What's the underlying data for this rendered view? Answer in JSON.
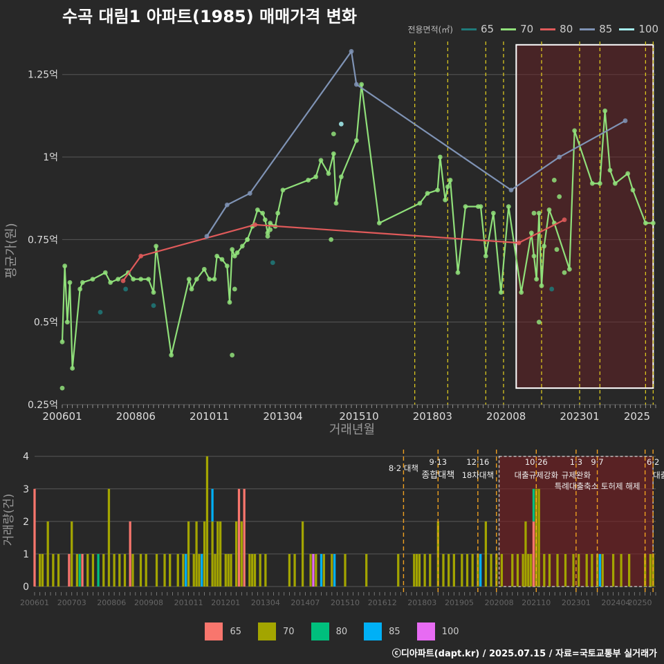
{
  "title": "수곡 대림1 아파트(1985) 매매가격 변화",
  "legend_title": "전용면적(㎡)",
  "credit": "ⓒ디아파트(dapt.kr) / 2025.07.15 / 자료=국토교통부 실거래가",
  "colors": {
    "background": "#282828",
    "grid": "#575757",
    "policy": "#e6d21e",
    "shade": "#6e1f24"
  },
  "price_series_colors": {
    "65": "#1f7a7a",
    "70": "#90e07a",
    "80": "#e05a5a",
    "85": "#7f93b5",
    "100": "#a5f1f2"
  },
  "volume_series_colors": {
    "65": "#f8766d",
    "70": "#a3a500",
    "80": "#00bf7d",
    "85": "#00b0f6",
    "100": "#e76bf3"
  },
  "chart_data": [
    {
      "type": "line",
      "name": "price",
      "xlabel": "거래년월",
      "ylabel": "평균가(원)",
      "x_ticks": [
        "200601",
        "200806",
        "201011",
        "201304",
        "201510",
        "201803",
        "202008",
        "202301",
        "2025"
      ],
      "y_ticks": [
        {
          "value": 0.25,
          "label": "0.25억"
        },
        {
          "value": 0.5,
          "label": "0.5억"
        },
        {
          "value": 0.75,
          "label": "0.75억"
        },
        {
          "value": 1.0,
          "label": "1억"
        },
        {
          "value": 1.25,
          "label": "1.25억"
        }
      ],
      "ylim": [
        0.25,
        1.35
      ],
      "x_start": "2006-01",
      "x_end": "2025-07",
      "legend_items": [
        "65",
        "70",
        "80",
        "85",
        "100"
      ],
      "highlight_box": {
        "from": "2020-12",
        "to": "2025-06",
        "ymin": 0.3,
        "ymax": 1.34
      },
      "policy_lines": [
        "2017-08",
        "2018-09",
        "2019-12",
        "2020-07",
        "2021-10",
        "2023-01",
        "2023-09",
        "2025-03",
        "2025-06"
      ],
      "series": [
        {
          "name": "70",
          "line": true,
          "points": [
            [
              "2006-01",
              0.44
            ],
            [
              "2006-02",
              0.67
            ],
            [
              "2006-03",
              0.5
            ],
            [
              "2006-04",
              0.62
            ],
            [
              "2006-05",
              0.36
            ],
            [
              "2006-08",
              0.6
            ],
            [
              "2006-09",
              0.62
            ],
            [
              "2007-01",
              0.63
            ],
            [
              "2007-06",
              0.65
            ],
            [
              "2007-08",
              0.62
            ],
            [
              "2007-11",
              0.63
            ],
            [
              "2008-03",
              0.65
            ],
            [
              "2008-05",
              0.63
            ],
            [
              "2008-08",
              0.63
            ],
            [
              "2008-11",
              0.63
            ],
            [
              "2009-01",
              0.59
            ],
            [
              "2009-02",
              0.73
            ],
            [
              "2009-08",
              0.4
            ],
            [
              "2010-03",
              0.63
            ],
            [
              "2010-04",
              0.6
            ],
            [
              "2010-06",
              0.63
            ],
            [
              "2010-09",
              0.66
            ],
            [
              "2010-11",
              0.63
            ],
            [
              "2011-01",
              0.63
            ],
            [
              "2011-02",
              0.7
            ],
            [
              "2011-04",
              0.69
            ],
            [
              "2011-06",
              0.67
            ],
            [
              "2011-07",
              0.56
            ],
            [
              "2011-08",
              0.72
            ],
            [
              "2011-09",
              0.7
            ],
            [
              "2011-10",
              0.71
            ],
            [
              "2011-12",
              0.73
            ],
            [
              "2012-02",
              0.75
            ],
            [
              "2012-04",
              0.79
            ],
            [
              "2012-06",
              0.84
            ],
            [
              "2012-08",
              0.83
            ],
            [
              "2012-09",
              0.81
            ],
            [
              "2012-10",
              0.77
            ],
            [
              "2012-11",
              0.8
            ],
            [
              "2013-01",
              0.79
            ],
            [
              "2013-02",
              0.83
            ],
            [
              "2013-04",
              0.9
            ],
            [
              "2014-02",
              0.93
            ],
            [
              "2014-05",
              0.94
            ],
            [
              "2014-07",
              0.99
            ],
            [
              "2014-10",
              0.95
            ],
            [
              "2014-12",
              1.01
            ],
            [
              "2015-01",
              0.86
            ],
            [
              "2015-03",
              0.94
            ],
            [
              "2015-09",
              1.05
            ],
            [
              "2015-11",
              1.22
            ],
            [
              "2016-06",
              0.8
            ],
            [
              "2017-10",
              0.86
            ],
            [
              "2018-01",
              0.89
            ],
            [
              "2018-05",
              0.9
            ],
            [
              "2018-06",
              1.0
            ],
            [
              "2018-08",
              0.87
            ],
            [
              "2018-09",
              0.91
            ],
            [
              "2018-10",
              0.93
            ],
            [
              "2019-01",
              0.65
            ],
            [
              "2019-04",
              0.85
            ],
            [
              "2019-09",
              0.85
            ],
            [
              "2019-10",
              0.85
            ],
            [
              "2019-12",
              0.7
            ],
            [
              "2020-03",
              0.83
            ],
            [
              "2020-06",
              0.59
            ],
            [
              "2020-09",
              0.85
            ],
            [
              "2021-02",
              0.59
            ],
            [
              "2021-06",
              0.77
            ],
            [
              "2021-07",
              0.7
            ],
            [
              "2021-08",
              0.63
            ],
            [
              "2021-09",
              0.83
            ],
            [
              "2021-10",
              0.61
            ],
            [
              "2021-11",
              0.73
            ],
            [
              "2022-01",
              0.84
            ],
            [
              "2022-03",
              0.8
            ],
            [
              "2022-09",
              0.66
            ],
            [
              "2022-11",
              1.08
            ],
            [
              "2023-06",
              0.92
            ],
            [
              "2023-09",
              0.92
            ],
            [
              "2023-11",
              1.14
            ],
            [
              "2024-01",
              0.96
            ],
            [
              "2024-03",
              0.92
            ],
            [
              "2024-08",
              0.95
            ],
            [
              "2024-10",
              0.9
            ],
            [
              "2025-03",
              0.8
            ],
            [
              "2025-06",
              0.8
            ]
          ]
        },
        {
          "name": "70",
          "line": false,
          "points": [
            [
              "2006-01",
              0.3
            ],
            [
              "2011-08",
              0.4
            ],
            [
              "2011-09",
              0.6
            ],
            [
              "2012-02",
              0.75
            ],
            [
              "2012-10",
              0.76
            ],
            [
              "2012-11",
              0.78
            ],
            [
              "2014-12",
              1.07
            ],
            [
              "2014-11",
              0.75
            ],
            [
              "2021-07",
              0.83
            ],
            [
              "2021-09",
              0.5
            ],
            [
              "2022-03",
              0.93
            ],
            [
              "2022-05",
              0.88
            ],
            [
              "2022-07",
              0.65
            ],
            [
              "2022-04",
              0.72
            ]
          ]
        },
        {
          "name": "65",
          "line": false,
          "points": [
            [
              "2007-04",
              0.53
            ],
            [
              "2008-02",
              0.6
            ],
            [
              "2009-01",
              0.55
            ],
            [
              "2012-12",
              0.68
            ],
            [
              "2022-02",
              0.6
            ]
          ]
        },
        {
          "name": "80",
          "line": true,
          "points": [
            [
              "2008-01",
              0.625
            ],
            [
              "2008-08",
              0.7
            ],
            [
              "2012-05",
              0.795
            ],
            [
              "2021-01",
              0.74
            ],
            [
              "2022-07",
              0.81
            ]
          ]
        },
        {
          "name": "85",
          "line": true,
          "points": [
            [
              "2010-10",
              0.76
            ],
            [
              "2011-06",
              0.855
            ],
            [
              "2012-03",
              0.89
            ],
            [
              "2015-07",
              1.32
            ],
            [
              "2015-09",
              1.22
            ],
            [
              "2020-10",
              0.9
            ],
            [
              "2022-05",
              1.0
            ],
            [
              "2024-07",
              1.11
            ]
          ]
        },
        {
          "name": "100",
          "line": false,
          "points": [
            [
              "2015-03",
              1.1
            ]
          ]
        }
      ]
    },
    {
      "type": "bar",
      "name": "volume",
      "xlabel": "",
      "ylabel": "거래량(건)",
      "x_ticks": [
        "200601",
        "200703",
        "200806",
        "200908",
        "201011",
        "201201",
        "201304",
        "201407",
        "201510",
        "201612",
        "201803",
        "201905",
        "202008",
        "202110",
        "202301",
        "202404",
        "20250"
      ],
      "y_ticks": [
        0,
        1,
        2,
        3,
        4
      ],
      "ylim": [
        0,
        4.1
      ],
      "x_start": "2006-01",
      "x_end": "2025-07",
      "highlight_box": {
        "from": "2020-08",
        "to": "2025-06",
        "ymin": 0,
        "ymax": 4.0
      },
      "policy_lines": [
        "2017-08",
        "2018-09",
        "2019-12",
        "2020-07",
        "2021-10",
        "2023-01",
        "2023-09",
        "2025-03",
        "2025-06"
      ],
      "annotations": [
        {
          "at": "2017-08",
          "date": "",
          "label": "8·2 대책"
        },
        {
          "at": "2018-09",
          "date": "9·13",
          "label": "종합대책"
        },
        {
          "at": "2019-12",
          "date": "12·16",
          "label": "18차대책"
        },
        {
          "at": "2021-10",
          "date": "10·26",
          "label": "대출규제강화"
        },
        {
          "at": "2023-01",
          "date": "1·3",
          "label": "규제완화"
        },
        {
          "at": "2023-09",
          "date": "9·7",
          "label": "특례대출축소 토허제 해제"
        },
        {
          "at": "2025-06",
          "date": "6·2",
          "label": "대출규"
        }
      ],
      "series": [
        {
          "name": "65",
          "values": {
            "2006-01": 3,
            "2007-02": 1,
            "2007-07": 1,
            "2009-01": 2,
            "2012-06": 3,
            "2012-08": 3,
            "2021-09": 2
          }
        },
        {
          "name": "70",
          "values": {
            "2006-03": 1,
            "2006-04": 1,
            "2006-06": 2,
            "2006-08": 1,
            "2006-10": 1,
            "2007-03": 2,
            "2007-05": 1,
            "2007-09": 1,
            "2007-11": 1,
            "2008-03": 1,
            "2008-05": 3,
            "2008-07": 1,
            "2008-09": 1,
            "2008-11": 1,
            "2009-02": 1,
            "2009-05": 1,
            "2009-07": 1,
            "2009-11": 1,
            "2010-02": 1,
            "2010-04": 1,
            "2010-07": 1,
            "2010-09": 1,
            "2010-11": 2,
            "2011-01": 1,
            "2011-02": 2,
            "2011-03": 1,
            "2011-05": 2,
            "2011-06": 4,
            "2011-08": 2,
            "2011-09": 1,
            "2011-10": 2,
            "2011-11": 2,
            "2012-01": 1,
            "2012-02": 1,
            "2012-03": 1,
            "2012-05": 2,
            "2012-07": 2,
            "2012-10": 1,
            "2012-11": 1,
            "2012-12": 1,
            "2013-02": 1,
            "2013-04": 1,
            "2014-01": 1,
            "2014-03": 1,
            "2014-06": 2,
            "2014-09": 1,
            "2014-11": 1,
            "2015-02": 1,
            "2015-05": 1,
            "2015-10": 1,
            "2016-06": 1,
            "2017-06": 1,
            "2017-12": 1,
            "2018-01": 1,
            "2018-02": 1,
            "2018-04": 1,
            "2018-06": 1,
            "2018-09": 2,
            "2018-11": 1,
            "2019-01": 1,
            "2019-03": 1,
            "2019-06": 1,
            "2019-08": 1,
            "2019-10": 1,
            "2019-12": 1,
            "2020-03": 2,
            "2020-05": 1,
            "2020-07": 1,
            "2020-09": 1,
            "2021-01": 1,
            "2021-03": 1,
            "2021-05": 1,
            "2021-06": 2,
            "2021-07": 1,
            "2021-08": 1,
            "2021-10": 3,
            "2021-11": 3,
            "2022-01": 1,
            "2022-03": 1,
            "2022-06": 1,
            "2022-09": 1,
            "2022-12": 1,
            "2023-02": 1,
            "2023-05": 1,
            "2023-07": 1,
            "2023-09": 1,
            "2023-11": 1,
            "2024-03": 1,
            "2024-06": 1,
            "2024-09": 1,
            "2025-03": 1,
            "2025-05": 1,
            "2025-06": 1
          }
        },
        {
          "name": "80",
          "values": {
            "2007-06": 1,
            "2008-01": 1,
            "2021-09": 1
          }
        },
        {
          "name": "85",
          "values": {
            "2010-10": 1,
            "2011-04": 1,
            "2011-08": 1,
            "2015-01": 1,
            "2015-06": 1,
            "2020-01": 1,
            "2023-10": 1
          }
        },
        {
          "name": "100",
          "values": {
            "2014-10": 1
          }
        }
      ]
    }
  ]
}
